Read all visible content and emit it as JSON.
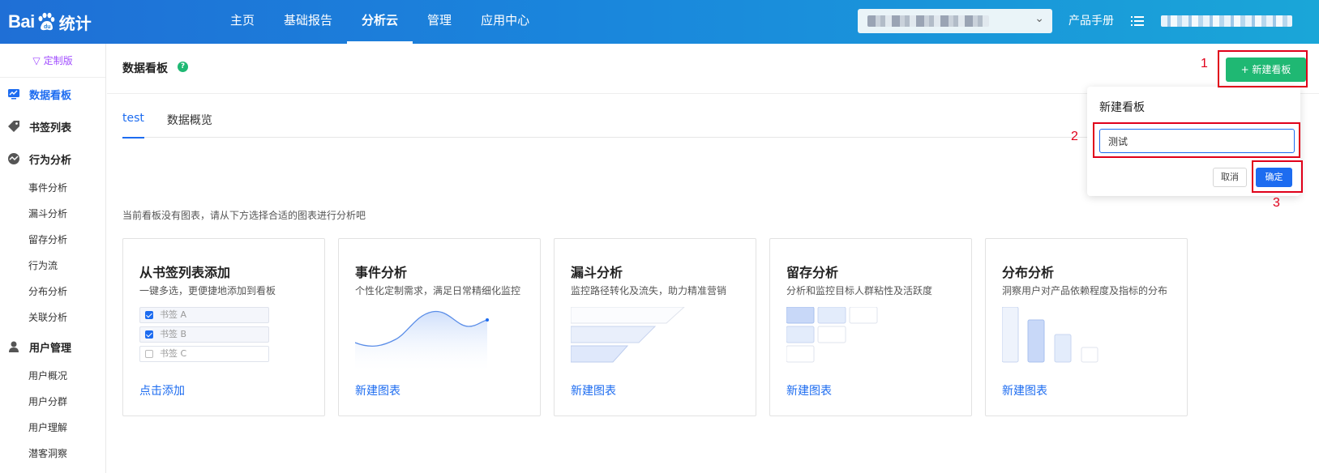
{
  "header": {
    "logo_text": "Bai",
    "logo_text_cn": "统计",
    "nav": [
      {
        "label": "主页",
        "active": false
      },
      {
        "label": "基础报告",
        "active": false
      },
      {
        "label": "分析云",
        "active": true
      },
      {
        "label": "管理",
        "active": false
      },
      {
        "label": "应用中心",
        "active": false
      }
    ],
    "manual_label": "产品手册"
  },
  "sidebar": {
    "edition_label": "定制版",
    "groups": [
      {
        "label": "数据看板",
        "icon": "dashboard-icon",
        "active": true,
        "items": []
      },
      {
        "label": "书签列表",
        "icon": "tag-icon",
        "active": false,
        "items": []
      },
      {
        "label": "行为分析",
        "icon": "behavior-icon",
        "active": false,
        "items": [
          "事件分析",
          "漏斗分析",
          "留存分析",
          "行为流",
          "分布分析",
          "关联分析"
        ]
      },
      {
        "label": "用户管理",
        "icon": "user-icon",
        "active": false,
        "items": [
          "用户概况",
          "用户分群",
          "用户理解",
          "潜客洞察"
        ]
      }
    ]
  },
  "main": {
    "page_title": "数据看板",
    "help_icon": "?",
    "tabs": [
      {
        "label": "test",
        "active": true
      },
      {
        "label": "数据概览",
        "active": false
      }
    ],
    "empty_hint": "当前看板没有图表，请从下方选择合适的图表进行分析吧",
    "cards": [
      {
        "title": "从书签列表添加",
        "desc": "一键多选，更便捷地添加到看板",
        "link": "点击添加",
        "illus": "bookmarks",
        "bookmarks": [
          {
            "label": "书签 A",
            "checked": true
          },
          {
            "label": "书签 B",
            "checked": true
          },
          {
            "label": "书签 C",
            "checked": false
          }
        ]
      },
      {
        "title": "事件分析",
        "desc": "个性化定制需求，满足日常精细化监控",
        "link": "新建图表",
        "illus": "line"
      },
      {
        "title": "漏斗分析",
        "desc": "监控路径转化及流失，助力精准营销",
        "link": "新建图表",
        "illus": "funnel"
      },
      {
        "title": "留存分析",
        "desc": "分析和监控目标人群粘性及活跃度",
        "link": "新建图表",
        "illus": "retention"
      },
      {
        "title": "分布分析",
        "desc": "洞察用户对产品依赖程度及指标的分布",
        "link": "新建图表",
        "illus": "distribution"
      }
    ]
  },
  "popover": {
    "new_button_label": "+ 新建看板",
    "title": "新建看板",
    "input_value": "测试",
    "cancel_label": "取消",
    "ok_label": "确定"
  },
  "annotations": [
    "1",
    "2",
    "3"
  ],
  "colors": {
    "brand_blue": "#1d6cf0",
    "green": "#1fb873",
    "edition_purple": "#a14dff",
    "annotation_red": "#e0001a"
  }
}
